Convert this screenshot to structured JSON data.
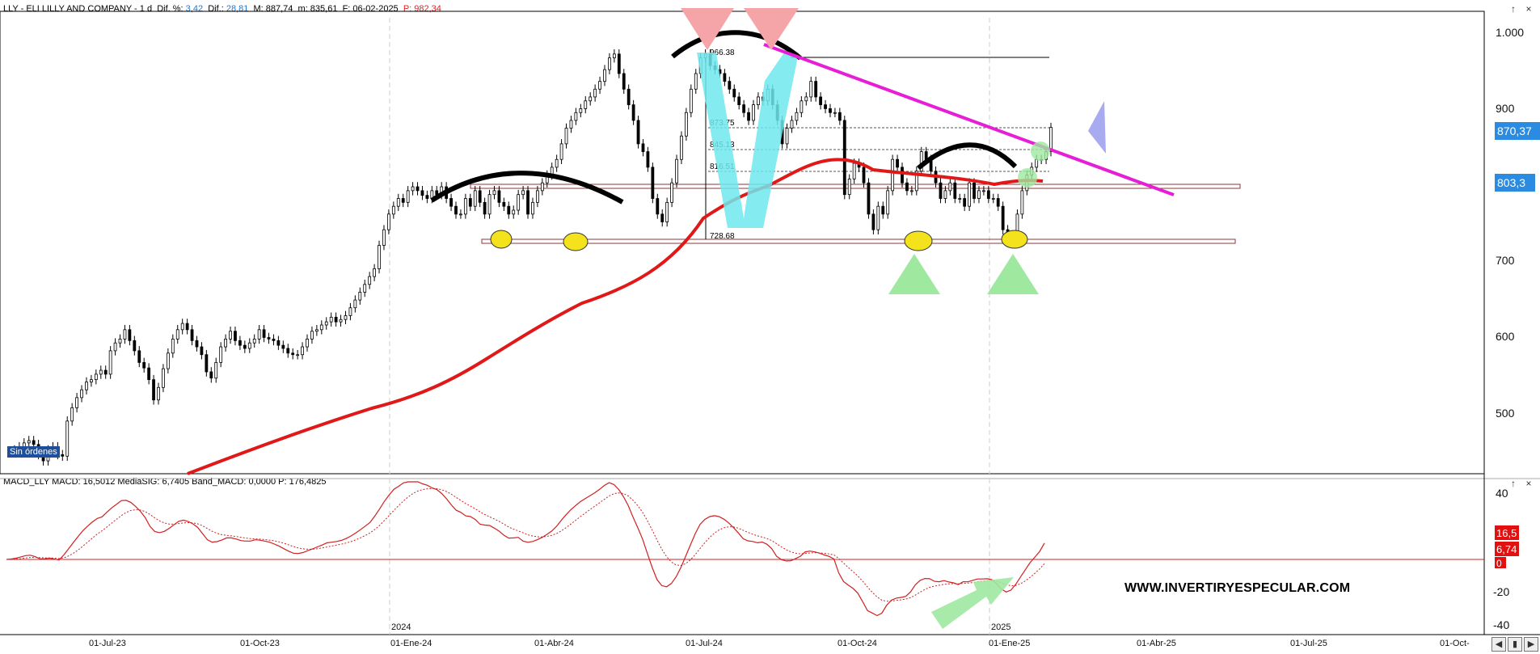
{
  "header": {
    "symbol": "LLY",
    "company": "ELI LILLY AND COMPANY",
    "interval": "1 d",
    "dif_pct_label": "Dif. %:",
    "dif_pct_value": "3,42",
    "dif_label": "Dif.:",
    "dif_value": "28,81",
    "max_value": "M: 887,74",
    "min_value": "m: 835,61",
    "date_value": "F: 06-02-2025",
    "p_value": "P: 982,34"
  },
  "macd_header": "MACD_LLY MACD: 16,5012  MediaSIG: 6,7405  Band_MACD: 0,0000  P: 176,4825",
  "price_axis": {
    "ticks": [
      "1.000",
      "900",
      "800",
      "700",
      "600",
      "500"
    ],
    "current_tag": "870,37",
    "sma_tag": "803,3"
  },
  "macd_axis": {
    "ticks": [
      "40",
      "20",
      "-20",
      "-40"
    ],
    "tags": [
      "16,5",
      "6,74",
      "0"
    ]
  },
  "annotations": {
    "level_966": "966.38",
    "level_873": "873.75",
    "level_845": "845.13",
    "level_816": "816.51",
    "level_728": "728.68"
  },
  "dates": [
    "01-Jul-23",
    "01-Oct-23",
    "01-Ene-24",
    "01-Abr-24",
    "01-Jul-24",
    "01-Oct-24",
    "01-Ene-25",
    "01-Abr-25",
    "01-Jul-25",
    "01-Oct-"
  ],
  "year_markers": [
    "2024",
    "2025"
  ],
  "sin_ordenes": "Sin órdenes",
  "watermark": "WWW.INVERTIRYESPECULAR.COM",
  "colors": {
    "sma": "#e01818",
    "trendline": "#e61fd6",
    "macd_line": "#d02020",
    "price_tag_bg": "#2b8be0",
    "macd_tag_bg": "#e11111",
    "support_ellipse": "#f3e21c",
    "green_triangle": "#9fe8a0",
    "red_triangle": "#f5a5a8",
    "cyan_v": "#6fe7ee",
    "blue_triangle": "#a8abf0"
  },
  "price_series": {
    "close": [
      455,
      458,
      462,
      467,
      470,
      465,
      452,
      444,
      458,
      462,
      452,
      450,
      495,
      512,
      525,
      535,
      545,
      548,
      555,
      560,
      555,
      585,
      595,
      600,
      612,
      598,
      585,
      570,
      563,
      548,
      522,
      538,
      562,
      582,
      600,
      612,
      620,
      612,
      598,
      590,
      580,
      558,
      550,
      570,
      590,
      600,
      610,
      598,
      592,
      588,
      595,
      600,
      612,
      602,
      600,
      598,
      592,
      588,
      582,
      580,
      580,
      590,
      600,
      610,
      612,
      618,
      622,
      628,
      622,
      625,
      630,
      640,
      650,
      660,
      670,
      680,
      690,
      720,
      740,
      760,
      770,
      780,
      775,
      790,
      795,
      790,
      784,
      780,
      790,
      785,
      795,
      780,
      770,
      760,
      760,
      780,
      770,
      790,
      775,
      760,
      785,
      790,
      775,
      770,
      760,
      765,
      785,
      790,
      760,
      775,
      790,
      800,
      810,
      820,
      830,
      850,
      870,
      880,
      890,
      895,
      905,
      910,
      920,
      930,
      945,
      960,
      965,
      940,
      920,
      900,
      880,
      850,
      840,
      820,
      780,
      760,
      750,
      775,
      800,
      830,
      860,
      890,
      920,
      940,
      960,
      965,
      950,
      945,
      940,
      930,
      920,
      910,
      900,
      890,
      880,
      900,
      910,
      905,
      920,
      900,
      880,
      850,
      870,
      880,
      890,
      905,
      910,
      930,
      910,
      900,
      895,
      890,
      890,
      880,
      785,
      805,
      825,
      820,
      800,
      760,
      740,
      770,
      760,
      790,
      830,
      820,
      800,
      790,
      790,
      815,
      840,
      830,
      815,
      800,
      780,
      790,
      800,
      780,
      780,
      770,
      800,
      780,
      790,
      790,
      780,
      780,
      770,
      740,
      725,
      730,
      760,
      790,
      810,
      820,
      830,
      830,
      840,
      871
    ]
  }
}
